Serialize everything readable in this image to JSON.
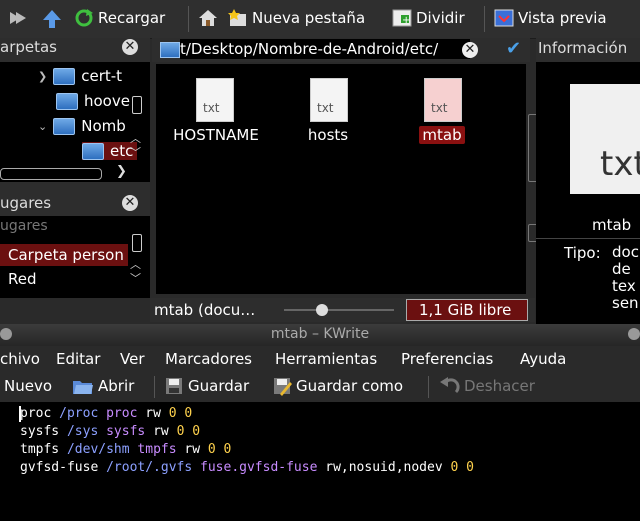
{
  "toolbar": {
    "reload_label": "Recargar",
    "new_tab_label": "Nueva pestaña",
    "split_label": "Dividir",
    "preview_label": "Vista previa"
  },
  "folders_panel": {
    "title": "arpetas",
    "items": [
      {
        "label": "cert-t"
      },
      {
        "label": "hoove"
      },
      {
        "label": "Nomb"
      },
      {
        "label": "etc"
      }
    ]
  },
  "places_panel": {
    "title": "ugares",
    "subtitle": "ugares",
    "items": [
      {
        "label": "Carpeta person"
      },
      {
        "label": "Red"
      }
    ]
  },
  "location": {
    "path": "t/Desktop/Nombre-de-Android/etc/"
  },
  "files": [
    {
      "name": "HOSTNAME",
      "icon_text": "txt",
      "selected": false
    },
    {
      "name": "hosts",
      "icon_text": "txt",
      "selected": false
    },
    {
      "name": "mtab",
      "icon_text": "txt",
      "selected": true
    }
  ],
  "status": {
    "file_info": "mtab (docu…",
    "free_space": "1,1 GiB libre"
  },
  "info_panel": {
    "title": "Información",
    "icon_text": "txt",
    "file_name": "mtab",
    "type_label": "Tipo:",
    "type_value_lines": [
      "doc",
      "de",
      "tex",
      "sen"
    ]
  },
  "kwrite": {
    "title": "mtab – KWrite",
    "menu": [
      "chivo",
      "Editar",
      "Ver",
      "Marcadores",
      "Herramientas",
      "Preferencias",
      "Ayuda"
    ],
    "actions": {
      "new": "Nuevo",
      "open": "Abrir",
      "save": "Guardar",
      "save_as": "Guardar como",
      "undo": "Deshacer"
    },
    "lines": [
      [
        {
          "t": "proc ",
          "c": "#ffffff"
        },
        {
          "t": "/proc ",
          "c": "#8ca0ff"
        },
        {
          "t": "proc ",
          "c": "#c88cff"
        },
        {
          "t": "rw ",
          "c": "#ffffff"
        },
        {
          "t": "0 0",
          "c": "#ffd24d"
        }
      ],
      [
        {
          "t": "sysfs ",
          "c": "#ffffff"
        },
        {
          "t": "/sys ",
          "c": "#8ca0ff"
        },
        {
          "t": "sysfs ",
          "c": "#c88cff"
        },
        {
          "t": "rw ",
          "c": "#ffffff"
        },
        {
          "t": "0 0",
          "c": "#ffd24d"
        }
      ],
      [
        {
          "t": "tmpfs ",
          "c": "#ffffff"
        },
        {
          "t": "/dev/shm ",
          "c": "#8ca0ff"
        },
        {
          "t": "tmpfs ",
          "c": "#c88cff"
        },
        {
          "t": "rw ",
          "c": "#ffffff"
        },
        {
          "t": "0 0",
          "c": "#ffd24d"
        }
      ],
      [
        {
          "t": "gvfsd-fuse ",
          "c": "#ffffff"
        },
        {
          "t": "/root/.gvfs ",
          "c": "#8ca0ff"
        },
        {
          "t": "fuse.gvfsd-fuse ",
          "c": "#c88cff"
        },
        {
          "t": "rw,nosuid,nodev ",
          "c": "#ffffff"
        },
        {
          "t": "0 0",
          "c": "#ffd24d"
        }
      ]
    ]
  }
}
